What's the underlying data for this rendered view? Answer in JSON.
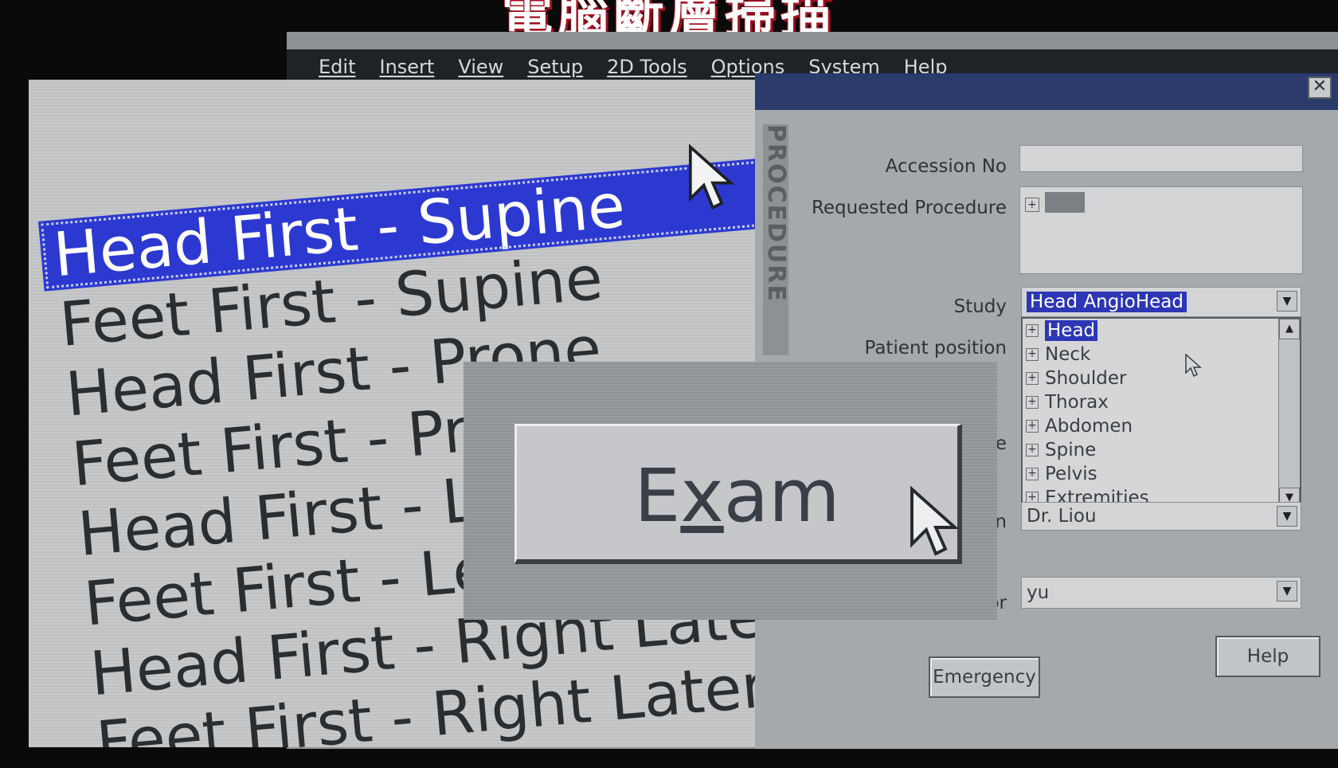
{
  "slide_title": "電腦斷層掃描",
  "menubar": {
    "items": [
      "Edit",
      "Insert",
      "View",
      "Setup",
      "2D Tools",
      "Options",
      "System",
      "Help"
    ]
  },
  "dialog": {
    "close_glyph": "✕",
    "side_label": "PROCEDURE",
    "accession_label": "Accession No",
    "accession_value": "",
    "requested_label": "Requested Procedure",
    "requested_value": "------",
    "study_label": "Study",
    "study_value": "Head AngioHead",
    "patient_position_label": "Patient position",
    "partial_label_e": "e",
    "partial_label_n": "n",
    "partial_label_or": "or",
    "physician_value": "Dr. Liou",
    "operator_value": "yu",
    "body_parts": [
      "Head",
      "Neck",
      "Shoulder",
      "Thorax",
      "Abdomen",
      "Spine",
      "Pelvis",
      "Extremities"
    ],
    "selected_body_part": "Head",
    "emergency_label": "Emergency",
    "help_label": "Help"
  },
  "zoom_position_list": {
    "items": [
      "Head First - Supine",
      "Feet First - Supine",
      "Head First - Prone",
      "Feet First - Prone",
      "Head First - Left Lateral",
      "Feet First - Left Lateral",
      "Head First - Right Lateral",
      "Feet First - Right Lateral"
    ],
    "selected_index": 0
  },
  "zoom_exam_button": {
    "label_first": "E",
    "label_underlined": "x",
    "label_rest": "am"
  },
  "colors": {
    "selection_blue": "#2c39d0",
    "dialog_title_blue": "#2a3b6c",
    "title_shadow_red": "#a01020"
  }
}
